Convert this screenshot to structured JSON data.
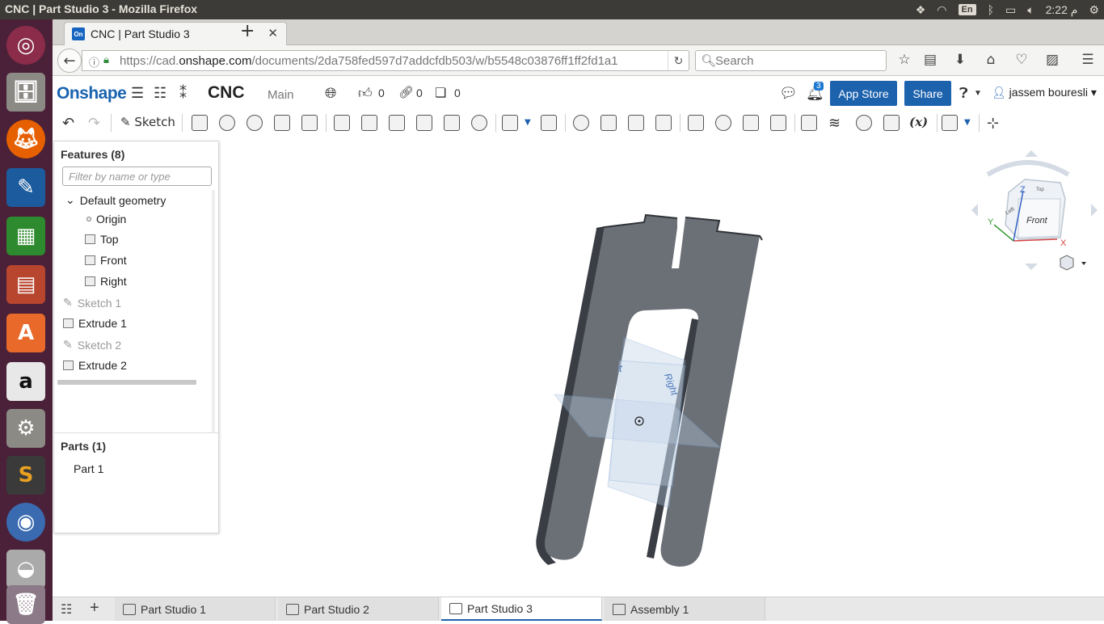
{
  "os": {
    "window_title": "CNC | Part Studio 3 - Mozilla Firefox",
    "language": "En",
    "clock": "2:22 م"
  },
  "browser": {
    "tab_title": "CNC | Part Studio 3",
    "favicon": "On",
    "url_prefix": "https://cad.",
    "url_domain": "onshape.com",
    "url_rest": "/documents/2da758fed597d7addcfdb503/w/b5548c03876ff1ff2fd1a1",
    "search_placeholder": "Search"
  },
  "header": {
    "logo": "Onshape",
    "document_name": "CNC",
    "branch": "Main",
    "likes": "0",
    "links": "0",
    "copies": "0",
    "notifications": "3",
    "app_store_label": "App Store",
    "share_label": "Share",
    "user_name": "jassem bouresli"
  },
  "toolbar": {
    "sketch_label": "Sketch",
    "variable_label": "(x)"
  },
  "features": {
    "title": "Features (8)",
    "filter_placeholder": "Filter by name or type",
    "default_geometry": "Default geometry",
    "items": [
      {
        "label": "Origin",
        "kind": "origin"
      },
      {
        "label": "Top",
        "kind": "plane"
      },
      {
        "label": "Front",
        "kind": "plane"
      },
      {
        "label": "Right",
        "kind": "plane"
      },
      {
        "label": "Sketch 1",
        "kind": "sketch"
      },
      {
        "label": "Extrude 1",
        "kind": "extrude"
      },
      {
        "label": "Sketch 2",
        "kind": "sketch"
      },
      {
        "label": "Extrude 2",
        "kind": "extrude"
      }
    ]
  },
  "parts": {
    "title": "Parts (1)",
    "items": [
      "Part 1"
    ]
  },
  "viewcube": {
    "front": "Front",
    "left": "Left",
    "top": "Top",
    "axis_x": "X",
    "axis_y": "Y",
    "axis_z": "Z"
  },
  "viewport": {
    "plane_front_label": "t",
    "plane_right_label": "Right"
  },
  "bottom_tabs": [
    {
      "label": "Part Studio 1",
      "active": false
    },
    {
      "label": "Part Studio 2",
      "active": false
    },
    {
      "label": "Part Studio 3",
      "active": true
    },
    {
      "label": "Assembly 1",
      "active": false
    }
  ],
  "colors": {
    "brand_blue": "#1d62ad",
    "part_gray": "#6b7077",
    "launcher": "#4a2138"
  }
}
